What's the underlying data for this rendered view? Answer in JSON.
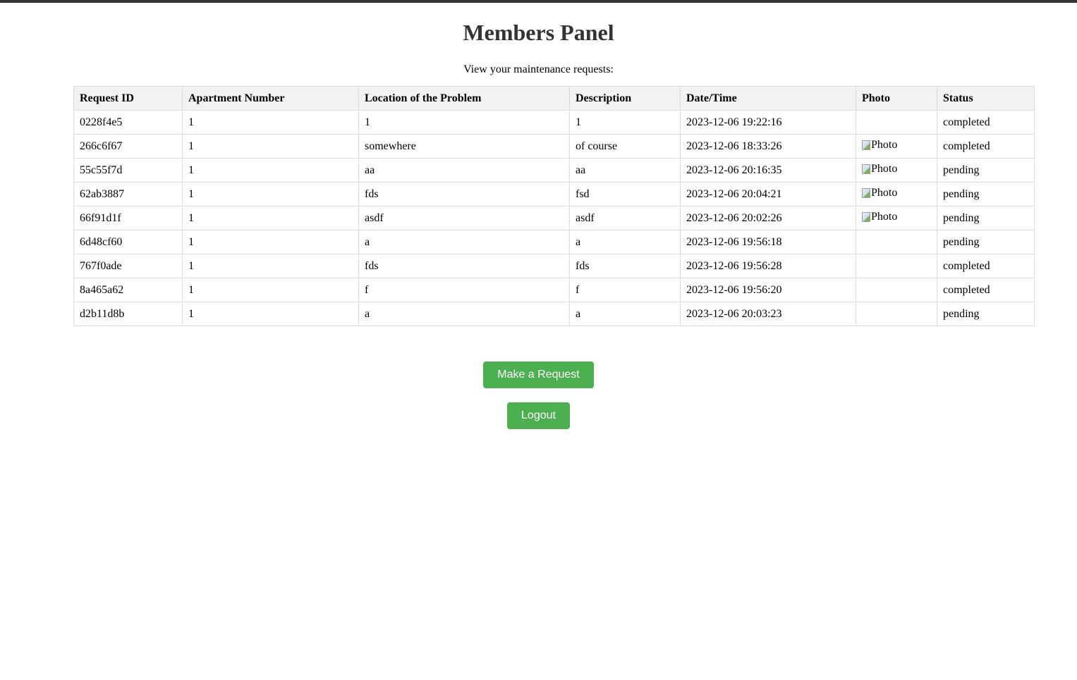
{
  "header": {
    "title": "Members Panel",
    "subtitle": "View your maintenance requests:"
  },
  "table": {
    "columns": [
      "Request ID",
      "Apartment Number",
      "Location of the Problem",
      "Description",
      "Date/Time",
      "Photo",
      "Status"
    ],
    "photo_alt": "Photo",
    "rows": [
      {
        "id": "0228f4e5",
        "apartment": "1",
        "location": "1",
        "description": "1",
        "datetime": "2023-12-06 19:22:16",
        "photo": "",
        "status": "completed"
      },
      {
        "id": "266c6f67",
        "apartment": "1",
        "location": "somewhere",
        "description": "of course",
        "datetime": "2023-12-06 18:33:26",
        "photo": "Photo",
        "status": "completed"
      },
      {
        "id": "55c55f7d",
        "apartment": "1",
        "location": "aa",
        "description": "aa",
        "datetime": "2023-12-06 20:16:35",
        "photo": "Photo",
        "status": "pending"
      },
      {
        "id": "62ab3887",
        "apartment": "1",
        "location": "fds",
        "description": "fsd",
        "datetime": "2023-12-06 20:04:21",
        "photo": "Photo",
        "status": "pending"
      },
      {
        "id": "66f91d1f",
        "apartment": "1",
        "location": "asdf",
        "description": "asdf",
        "datetime": "2023-12-06 20:02:26",
        "photo": "Photo",
        "status": "pending"
      },
      {
        "id": "6d48cf60",
        "apartment": "1",
        "location": "a",
        "description": "a",
        "datetime": "2023-12-06 19:56:18",
        "photo": "",
        "status": "pending"
      },
      {
        "id": "767f0ade",
        "apartment": "1",
        "location": "fds",
        "description": "fds",
        "datetime": "2023-12-06 19:56:28",
        "photo": "",
        "status": "completed"
      },
      {
        "id": "8a465a62",
        "apartment": "1",
        "location": "f",
        "description": "f",
        "datetime": "2023-12-06 19:56:20",
        "photo": "",
        "status": "completed"
      },
      {
        "id": "d2b11d8b",
        "apartment": "1",
        "location": "a",
        "description": "a",
        "datetime": "2023-12-06 20:03:23",
        "photo": "",
        "status": "pending"
      }
    ]
  },
  "actions": {
    "make_request_label": "Make a Request",
    "logout_label": "Logout"
  },
  "colors": {
    "button": "#4caf50",
    "header_bg": "#f2f2f2",
    "border": "#dddddd",
    "title": "#333333"
  }
}
